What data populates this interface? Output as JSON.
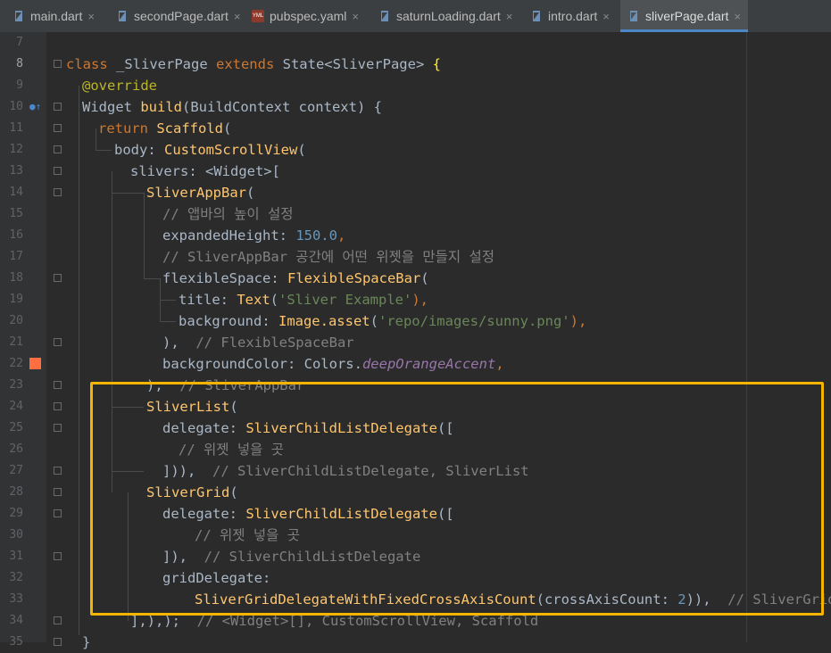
{
  "tabs": [
    {
      "label": "main.dart",
      "icon": "dart-file-icon"
    },
    {
      "label": "secondPage.dart",
      "icon": "dart-file-icon"
    },
    {
      "label": "pubspec.yaml",
      "icon": "yaml-file-icon",
      "icon_text": "YML"
    },
    {
      "label": "saturnLoading.dart",
      "icon": "dart-file-icon"
    },
    {
      "label": "intro.dart",
      "icon": "dart-file-icon"
    },
    {
      "label": "sliverPage.dart",
      "icon": "dart-file-icon",
      "active": true
    }
  ],
  "tab_close_glyph": "×",
  "line_numbers": [
    "7",
    "8",
    "9",
    "10",
    "11",
    "12",
    "13",
    "14",
    "15",
    "16",
    "17",
    "18",
    "19",
    "20",
    "21",
    "22",
    "23",
    "24",
    "25",
    "26",
    "27",
    "28",
    "29",
    "30",
    "31",
    "32",
    "33",
    "34",
    "35"
  ],
  "code": {
    "l8": {
      "t1": "class ",
      "t2": "_SliverPage ",
      "t3": "extends ",
      "t4": "State<SliverPage> ",
      "t5": "{"
    },
    "l9": {
      "t1": "@override"
    },
    "l10": {
      "t1": "Widget ",
      "t2": "build",
      "t3": "(BuildContext context) {"
    },
    "l11": {
      "t1": "return ",
      "t2": "Scaffold",
      "t3": "("
    },
    "l12": {
      "t1": "body: ",
      "t2": "CustomScrollView",
      "t3": "("
    },
    "l13": {
      "t1": "slivers: <Widget>["
    },
    "l14": {
      "t1": "SliverAppBar",
      "t2": "("
    },
    "l15": {
      "t1": "// 앱바의 높이 설정"
    },
    "l16": {
      "t1": "expandedHeight: ",
      "t2": "150.0",
      "t3": ","
    },
    "l17": {
      "t1": "// SliverAppBar 공간에 어떤 위젯을 만들지 설정"
    },
    "l18": {
      "t1": "flexibleSpace: ",
      "t2": "FlexibleSpaceBar",
      "t3": "("
    },
    "l19": {
      "t1": "title: ",
      "t2": "Text",
      "t3": "(",
      "t4": "'Sliver Example'",
      "t5": "),"
    },
    "l20": {
      "t1": "background: ",
      "t2": "Image.asset",
      "t3": "(",
      "t4": "'repo/images/sunny.png'",
      "t5": "),"
    },
    "l21": {
      "t1": "),  ",
      "t2": "// FlexibleSpaceBar"
    },
    "l22": {
      "t1": "backgroundColor: Colors.",
      "t2": "deepOrangeAccent",
      "t3": ","
    },
    "l23": {
      "t1": "),  ",
      "t2": "// SliverAppBar"
    },
    "l24": {
      "t1": "SliverList",
      "t2": "("
    },
    "l25": {
      "t1": "delegate: ",
      "t2": "SliverChildListDelegate",
      "t3": "(["
    },
    "l26": {
      "t1": "// 위젯 넣을 곳"
    },
    "l27": {
      "t1": "])),  ",
      "t2": "// SliverChildListDelegate, SliverList"
    },
    "l28": {
      "t1": "SliverGrid",
      "t2": "("
    },
    "l29": {
      "t1": "delegate: ",
      "t2": "SliverChildListDelegate",
      "t3": "(["
    },
    "l30": {
      "t1": "// 위젯 넣을 곳"
    },
    "l31": {
      "t1": "]),  ",
      "t2": "// SliverChildListDelegate"
    },
    "l32": {
      "t1": "gridDelegate:"
    },
    "l33": {
      "t1": "SliverGridDelegateWithFixedCrossAxisCount",
      "t2": "(crossAxisCount: ",
      "t3": "2",
      "t4": ")),  ",
      "t5": "// SliverGrid"
    },
    "l34": {
      "t1": "],),);  ",
      "t2": "// <Widget>[], CustomScrollView, Scaffold"
    },
    "l35": {
      "t1": "}"
    }
  },
  "colors": {
    "editor_bg": "#2b2b2b",
    "keyword": "#cc7832",
    "function": "#ffc66d",
    "string": "#6a8759",
    "number": "#6897bb",
    "comment": "#808080",
    "highlight_box": "#f5b400",
    "breakpoint_color_swatch": "#ff6e40"
  }
}
